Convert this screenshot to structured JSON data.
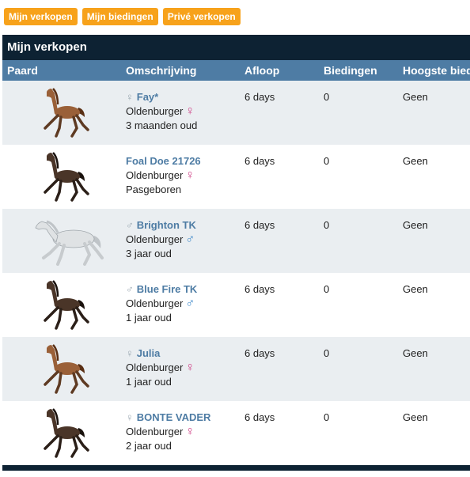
{
  "tabs": [
    "Mijn verkopen",
    "Mijn biedingen",
    "Privé verkopen"
  ],
  "panel_title": "Mijn verkopen",
  "columns": [
    "Paard",
    "Omschrijving",
    "Afloop",
    "Biedingen",
    "Hoogste bieder"
  ],
  "rows": [
    {
      "coat": "chestnut",
      "sex_symbol": "♀",
      "name": "Fay*",
      "breed": "Oldenburger",
      "gender_icon": "♀",
      "gender": "female",
      "age": "3 maanden oud",
      "afloop": "6 days",
      "biedingen": "0",
      "hoogste": "Geen"
    },
    {
      "coat": "darkbay",
      "sex_symbol": "",
      "name": "Foal Doe 21726",
      "breed": "Oldenburger",
      "gender_icon": "♀",
      "gender": "female",
      "age": "Pasgeboren",
      "afloop": "6 days",
      "biedingen": "0",
      "hoogste": "Geen"
    },
    {
      "coat": "grey",
      "sex_symbol": "♂",
      "name": "Brighton TK",
      "breed": "Oldenburger",
      "gender_icon": "♂",
      "gender": "male",
      "age": "3 jaar oud",
      "afloop": "6 days",
      "biedingen": "0",
      "hoogste": "Geen"
    },
    {
      "coat": "darkbay",
      "sex_symbol": "♂",
      "name": "Blue Fire TK",
      "breed": "Oldenburger",
      "gender_icon": "♂",
      "gender": "male",
      "age": "1 jaar oud",
      "afloop": "6 days",
      "biedingen": "0",
      "hoogste": "Geen"
    },
    {
      "coat": "chestnut",
      "sex_symbol": "♀",
      "name": "Julia",
      "breed": "Oldenburger",
      "gender_icon": "♀",
      "gender": "female",
      "age": "1 jaar oud",
      "afloop": "6 days",
      "biedingen": "0",
      "hoogste": "Geen"
    },
    {
      "coat": "darkbay",
      "sex_symbol": "♀",
      "name": "BONTE VADER",
      "breed": "Oldenburger",
      "gender_icon": "♀",
      "gender": "female",
      "age": "2 jaar oud",
      "afloop": "6 days",
      "biedingen": "0",
      "hoogste": "Geen"
    }
  ],
  "colors": {
    "tab": "#f7a21b",
    "title_bar": "#0d2233",
    "header": "#4e7ca4",
    "row_alt": "#eaeef1",
    "female": "#d0468a",
    "male": "#3a86c8"
  }
}
